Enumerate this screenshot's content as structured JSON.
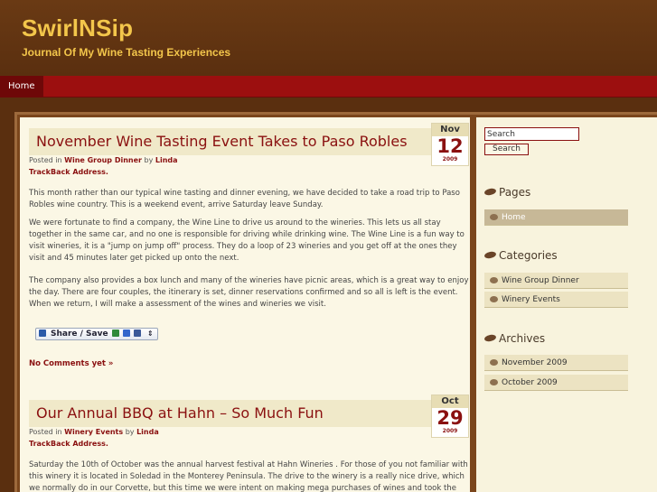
{
  "site": {
    "title": "SwirlNSip",
    "tagline": "Journal Of My Wine Tasting Experiences"
  },
  "nav": {
    "home": "Home"
  },
  "posts": [
    {
      "title": "November Wine Tasting Event Takes to Paso Robles",
      "date": {
        "month": "Nov",
        "day": "12",
        "year": "2009"
      },
      "meta_prefix": "Posted in",
      "category": "Wine Group Dinner",
      "meta_by": "by",
      "author": "Linda",
      "trackback": "TrackBack Address.",
      "paragraphs": [
        "This month rather than our typical wine tasting and dinner evening, we have decided to take a road trip to Paso Robles wine country.  This is a weekend event, arrive Saturday leave Sunday.",
        "We were fortunate to find a company, the Wine Line to drive us around to the wineries. This lets us all stay together in the same car, and no one is responsible for driving while drinking wine. The Wine Line is a fun way to visit wineries, it is a \"jump on jump off\" process. They do a loop of 23 wineries and you get off at the ones they visit and 45 minutes later get picked up onto the next.",
        "The company also provides a box lunch and many of the wineries have picnic areas, which is a great way to enjoy the day. There are four couples, the itinerary is set, dinner reservations confirmed and so all is left is the event. When we return, I will make a assessment of the wines and wineries we visit."
      ],
      "share_label": "Share / Save",
      "comments": "No Comments yet »"
    },
    {
      "title": "Our Annual BBQ at Hahn – So Much Fun",
      "date": {
        "month": "Oct",
        "day": "29",
        "year": "2009"
      },
      "meta_prefix": "Posted in",
      "category": "Winery Events",
      "meta_by": "by",
      "author": "Linda",
      "trackback": "TrackBack Address.",
      "paragraphs": [
        "Saturday the 10th of October was the annual harvest festival at Hahn Wineries . For those of you not familiar with this winery it is located in Soledad in the Monterey Peninsula. The drive to the winery is a really nice drive, which we normally do in our Corvette, but this time we were intent on making mega purchases of wines and took the"
      ]
    }
  ],
  "sidebar": {
    "search_value": "Search",
    "search_button": "Search",
    "pages": {
      "title": "Pages",
      "items": [
        "Home"
      ]
    },
    "categories": {
      "title": "Categories",
      "items": [
        "Wine Group Dinner",
        "Winery Events"
      ]
    },
    "archives": {
      "title": "Archives",
      "items": [
        "November 2009",
        "October 2009"
      ]
    }
  },
  "colors": {
    "background": "#5a2f0f",
    "title_gold": "#f3c64b",
    "nav_red": "#9c0f0f",
    "link_red": "#8a1010",
    "content_bg": "#fbf7e5"
  },
  "icons": [
    "leaf-icon",
    "share-plus-icon",
    "email-icon",
    "delicious-icon",
    "facebook-icon",
    "arrows-icon"
  ]
}
